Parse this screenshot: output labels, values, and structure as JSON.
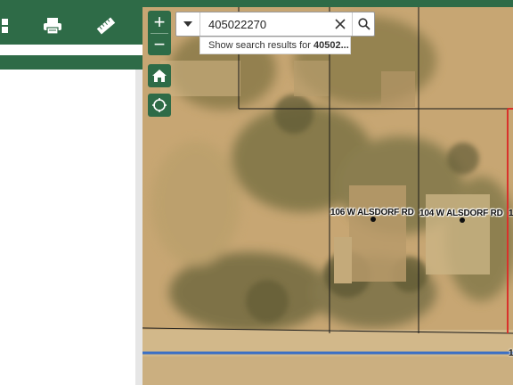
{
  "search": {
    "value": "405022270",
    "suggestion_prefix": "Show search results for ",
    "suggestion_bold": "40502..."
  },
  "zoom": {
    "in_label": "+",
    "out_label": "−"
  },
  "addresses": [
    {
      "label": "106 W ALSDORF RD"
    },
    {
      "label": "104 W ALSDORF RD"
    }
  ],
  "edge_labels": {
    "right_top": "1",
    "right_bottom": "1"
  },
  "colors": {
    "toolbar_green": "#2e6b47",
    "parcel_line": "#1a1a1a",
    "road_line": "#3b6fc4",
    "selected_parcel": "#d9312b"
  },
  "icons": {
    "toolbar": [
      "grid-icon",
      "print-icon",
      "measure-ruler-icon"
    ],
    "map": [
      "home-icon",
      "locate-icon",
      "search-icon",
      "dropdown-arrow-icon",
      "clear-icon"
    ]
  }
}
